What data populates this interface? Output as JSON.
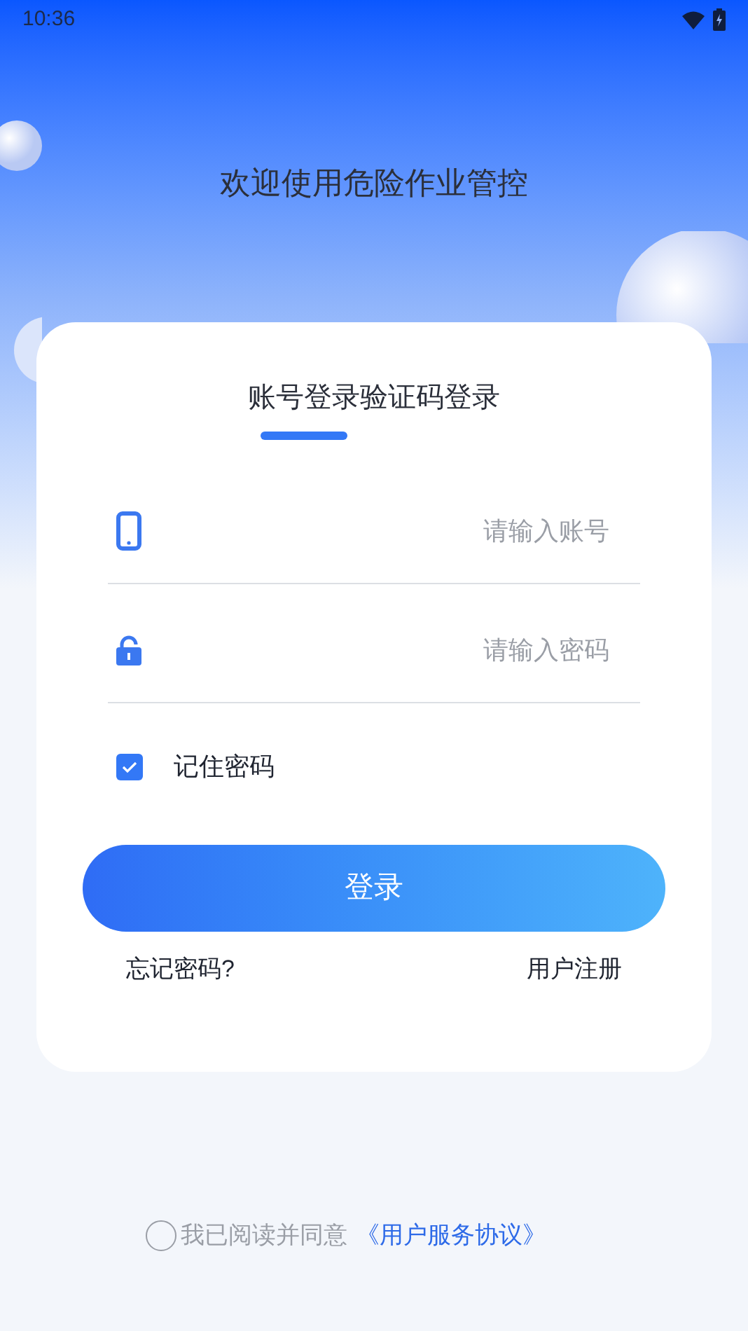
{
  "status_bar": {
    "time": "10:36"
  },
  "title": "欢迎使用危险作业管控",
  "tabs": [
    {
      "label": "账号登录",
      "selected": true
    },
    {
      "label": "验证码登录",
      "selected": false
    }
  ],
  "fields": [
    {
      "kind": "phone",
      "placeholder": "请输入账号"
    },
    {
      "kind": "lock",
      "placeholder": "请输入密码"
    }
  ],
  "remember": {
    "label": "记住密码",
    "checked": true
  },
  "login_button": "登录",
  "links": [
    "忘记密码?",
    "用户注册"
  ],
  "agreement": {
    "checked": false,
    "text": "我已阅读并同意",
    "link": "《用户服务协议》"
  }
}
